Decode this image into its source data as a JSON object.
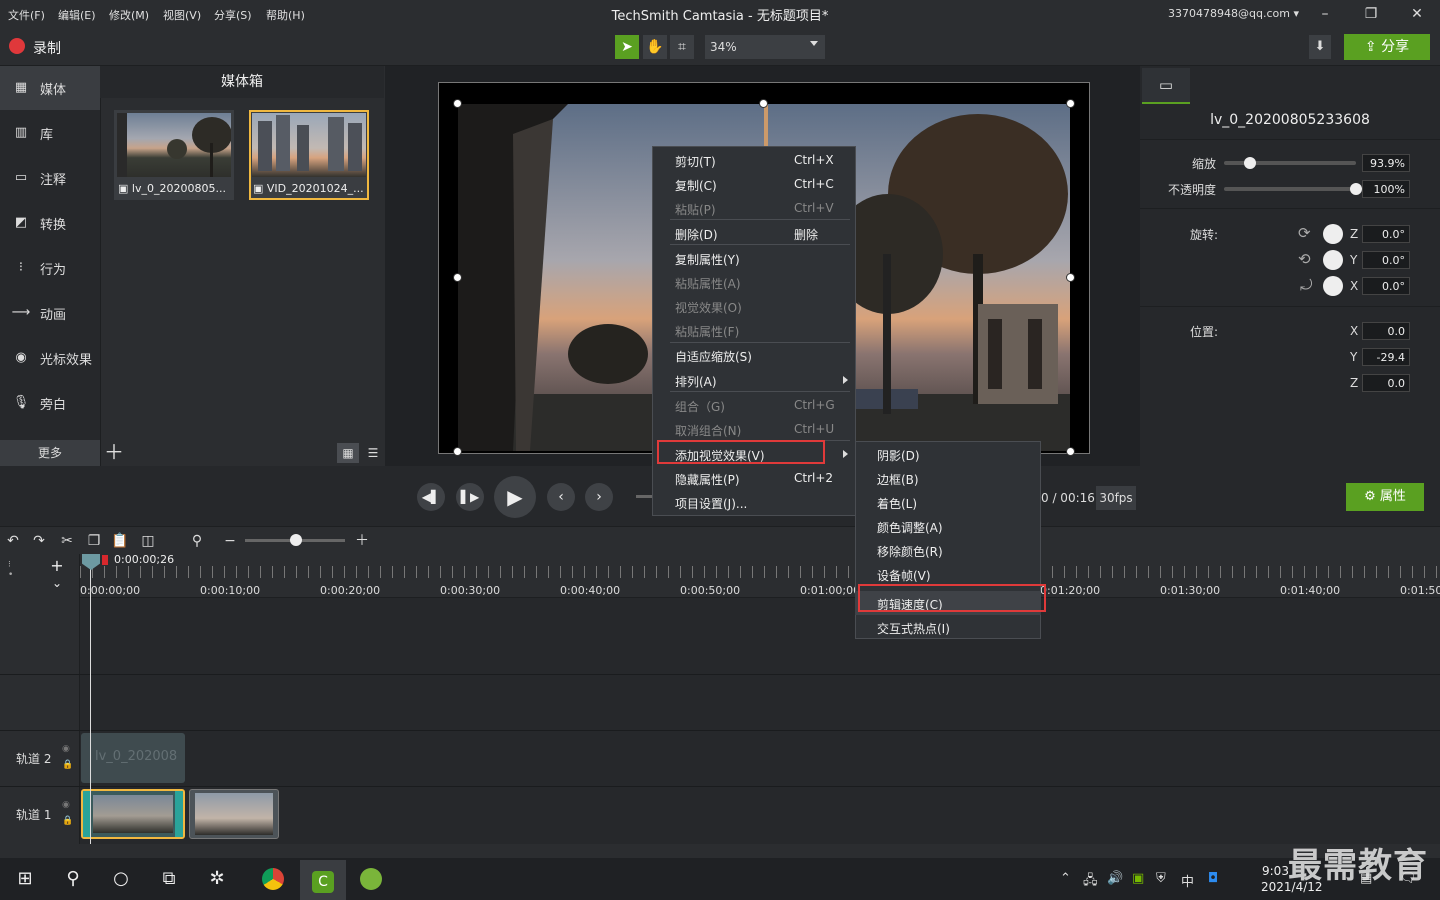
{
  "menubar": {
    "items": [
      "文件(F)",
      "编辑(E)",
      "修改(M)",
      "视图(V)",
      "分享(S)",
      "帮助(H)"
    ],
    "title": "TechSmith Camtasia - 无标题项目*",
    "account": "3370478948@qq.com"
  },
  "toolbar": {
    "record_label": "录制",
    "zoom": "34%",
    "share_label": "分享",
    "accent_color": "#5aa021",
    "record_color": "#e0383b"
  },
  "sidebar": {
    "items": [
      {
        "label": "媒体",
        "icon": "film-icon"
      },
      {
        "label": "库",
        "icon": "library-icon"
      },
      {
        "label": "注释",
        "icon": "annotation-icon"
      },
      {
        "label": "转换",
        "icon": "transition-icon"
      },
      {
        "label": "行为",
        "icon": "behavior-icon"
      },
      {
        "label": "动画",
        "icon": "animation-icon"
      },
      {
        "label": "光标效果",
        "icon": "cursor-icon"
      },
      {
        "label": "旁白",
        "icon": "microphone-icon"
      }
    ],
    "more_label": "更多"
  },
  "media_bin": {
    "title": "媒体箱",
    "items": [
      {
        "name": "lv_0_20200805..."
      },
      {
        "name": "VID_20201024_..."
      }
    ]
  },
  "properties": {
    "clip_name": "lv_0_20200805233608",
    "scale_label": "缩放",
    "scale_value": "93.9%",
    "scale_level": 0.2,
    "opacity_label": "不透明度",
    "opacity_value": "100%",
    "opacity_level": 1.0,
    "rotation_label": "旋转:",
    "rot_z": "0.0°",
    "rot_y": "0.0°",
    "rot_x": "0.0°",
    "axis_z": "Z",
    "axis_y": "Y",
    "axis_x": "X",
    "position_label": "位置:",
    "pos_x": "0.0",
    "pos_y": "-29.4",
    "pos_z": "0.0",
    "button_label": "属性"
  },
  "playback": {
    "time": "0 / 00:16",
    "fps": "30fps"
  },
  "timeline": {
    "playhead_time": "0:00:00;26",
    "ticks": [
      "0:00:00;00",
      "0:00:10;00",
      "0:00:20;00",
      "0:00:30;00",
      "0:00:40;00",
      "0:00:50;00",
      "0:01:00;00",
      "0:01:20;00",
      "0:01:30;00",
      "0:01:40;00",
      "0:01:50;"
    ],
    "tracks": [
      {
        "label": "轨道 2",
        "clip_label": "lv_0_202008"
      },
      {
        "label": "轨道 1"
      }
    ]
  },
  "context_menu": {
    "items": [
      {
        "label": "剪切(T)",
        "shortcut": "Ctrl+X",
        "enabled": true
      },
      {
        "label": "复制(C)",
        "shortcut": "Ctrl+C",
        "enabled": true
      },
      {
        "label": "粘贴(P)",
        "shortcut": "Ctrl+V",
        "enabled": false
      },
      {
        "label": "删除(D)",
        "shortcut": "删除",
        "enabled": true
      },
      {
        "label": "复制属性(Y)",
        "shortcut": "",
        "enabled": true
      },
      {
        "label": "粘贴属性(A)",
        "shortcut": "",
        "enabled": false
      },
      {
        "label": "视觉效果(O)",
        "shortcut": "",
        "enabled": false
      },
      {
        "label": "粘贴属性(F)",
        "shortcut": "",
        "enabled": false
      },
      {
        "label": "自适应缩放(S)",
        "shortcut": "",
        "enabled": true
      },
      {
        "label": "排列(A)",
        "shortcut": "",
        "enabled": true
      },
      {
        "label": "组合（G)",
        "shortcut": "Ctrl+G",
        "enabled": false
      },
      {
        "label": "取消组合(N)",
        "shortcut": "Ctrl+U",
        "enabled": false
      },
      {
        "label": "添加视觉效果(V)",
        "shortcut": "",
        "enabled": true
      },
      {
        "label": "隐藏属性(P)",
        "shortcut": "Ctrl+2",
        "enabled": true
      },
      {
        "label": "项目设置(J)...",
        "shortcut": "",
        "enabled": true
      }
    ]
  },
  "submenu": {
    "items": [
      "阴影(D)",
      "边框(B)",
      "着色(L)",
      "颜色调整(A)",
      "移除颜色(R)",
      "设备帧(V)",
      "剪辑速度(C)",
      "交互式热点(I)"
    ]
  },
  "taskbar": {
    "time": "9:03",
    "date": "2021/4/12"
  },
  "watermark": "最需教育"
}
